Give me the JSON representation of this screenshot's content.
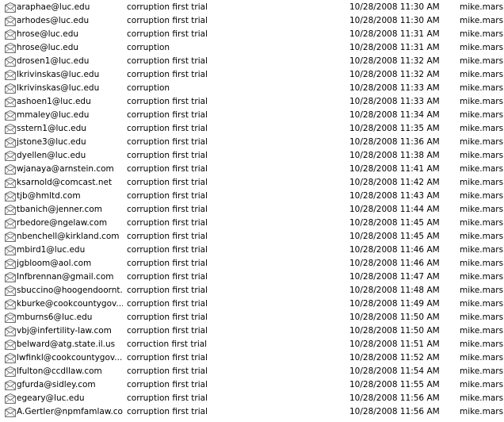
{
  "messages": [
    {
      "from": "araphae@luc.edu",
      "subject": "corruption first trial",
      "received": "10/28/2008 11:30 AM",
      "account": "mike.mars",
      "icon": "envelope-icon"
    },
    {
      "from": "arhodes@luc.edu",
      "subject": "corruption first trial",
      "received": "10/28/2008 11:30 AM",
      "account": "mike.mars",
      "icon": "envelope-icon"
    },
    {
      "from": "hrose@luc.edu",
      "subject": "corruption first trial",
      "received": "10/28/2008 11:31 AM",
      "account": "mike.mars",
      "icon": "envelope-icon"
    },
    {
      "from": "hrose@luc.edu",
      "subject": "corruption",
      "received": "10/28/2008 11:31 AM",
      "account": "mike.mars",
      "icon": "envelope-icon"
    },
    {
      "from": "drosen1@luc.edu",
      "subject": "corruption first trial",
      "received": "10/28/2008 11:32 AM",
      "account": "mike.mars",
      "icon": "envelope-icon"
    },
    {
      "from": "lkrivinskas@luc.edu",
      "subject": "corruption first trial",
      "received": "10/28/2008 11:32 AM",
      "account": "mike.mars",
      "icon": "envelope-icon"
    },
    {
      "from": "lkrivinskas@luc.edu",
      "subject": "corruption",
      "received": "10/28/2008 11:33 AM",
      "account": "mike.mars",
      "icon": "envelope-icon"
    },
    {
      "from": "ashoen1@luc.edu",
      "subject": "corruption first trial",
      "received": "10/28/2008 11:33 AM",
      "account": "mike.mars",
      "icon": "envelope-icon"
    },
    {
      "from": "mmaley@luc.edu",
      "subject": "corruption first trial",
      "received": "10/28/2008 11:34 AM",
      "account": "mike.mars",
      "icon": "envelope-icon"
    },
    {
      "from": "sstern1@luc.edu",
      "subject": "corruption first trial",
      "received": "10/28/2008 11:35 AM",
      "account": "mike.mars",
      "icon": "envelope-icon"
    },
    {
      "from": "jstone3@luc.edu",
      "subject": "corruption first trial",
      "received": "10/28/2008 11:36 AM",
      "account": "mike.mars",
      "icon": "envelope-icon"
    },
    {
      "from": "dyellen@luc.edu",
      "subject": "corruption first trial",
      "received": "10/28/2008 11:38 AM",
      "account": "mike.mars",
      "icon": "envelope-icon"
    },
    {
      "from": "wjanaya@arnstein.com",
      "subject": "corruption first trial",
      "received": "10/28/2008 11:41 AM",
      "account": "mike.mars",
      "icon": "envelope-icon"
    },
    {
      "from": "ksarnold@comcast.net",
      "subject": "corruption first trial",
      "received": "10/28/2008 11:42 AM",
      "account": "mike.mars",
      "icon": "envelope-icon"
    },
    {
      "from": "tjb@hmltd.com",
      "subject": "corruption first trial",
      "received": "10/28/2008 11:43 AM",
      "account": "mike.mars",
      "icon": "envelope-icon"
    },
    {
      "from": "tbanich@jenner.com",
      "subject": "corruption first trial",
      "received": "10/28/2008 11:44 AM",
      "account": "mike.mars",
      "icon": "envelope-icon"
    },
    {
      "from": "rbedore@ngelaw.com",
      "subject": "corruption first trial",
      "received": "10/28/2008 11:45 AM",
      "account": "mike.mars",
      "icon": "envelope-icon"
    },
    {
      "from": "nbenchell@kirkland.com",
      "subject": "corruption first trial",
      "received": "10/28/2008 11:45 AM",
      "account": "mike.mars",
      "icon": "envelope-icon"
    },
    {
      "from": "mbird1@luc.edu",
      "subject": "corruption first trial",
      "received": "10/28/2008 11:46 AM",
      "account": "mike.mars",
      "icon": "envelope-icon"
    },
    {
      "from": "jgbloom@aol.com",
      "subject": "corruption first trial",
      "received": "10/28/2008 11:46 AM",
      "account": "mike.mars",
      "icon": "envelope-icon"
    },
    {
      "from": "Infbrennan@gmail.com",
      "subject": "corruption first trial",
      "received": "10/28/2008 11:47 AM",
      "account": "mike.mars",
      "icon": "envelope-icon"
    },
    {
      "from": "sbuccino@hoogendoornt....",
      "subject": "corruption first trial",
      "received": "10/28/2008 11:48 AM",
      "account": "mike.mars",
      "icon": "envelope-icon"
    },
    {
      "from": "kburke@cookcountygov....",
      "subject": "corruption first trial",
      "received": "10/28/2008 11:49 AM",
      "account": "mike.mars",
      "icon": "envelope-icon"
    },
    {
      "from": "mburns6@luc.edu",
      "subject": "corruption first trial",
      "received": "10/28/2008 11:50 AM",
      "account": "mike.mars",
      "icon": "envelope-icon"
    },
    {
      "from": "vbj@infertility-law.com",
      "subject": "corruption first trial",
      "received": "10/28/2008 11:50 AM",
      "account": "mike.mars",
      "icon": "envelope-icon"
    },
    {
      "from": "belward@atg.state.il.us",
      "subject": "corruction first trial",
      "received": "10/28/2008 11:51 AM",
      "account": "mike.mars",
      "icon": "envelope-icon"
    },
    {
      "from": "lwfinkl@cookcountygov....",
      "subject": "corruption first trial",
      "received": "10/28/2008 11:52 AM",
      "account": "mike.mars",
      "icon": "envelope-icon"
    },
    {
      "from": "lfulton@ccdllaw.com",
      "subject": "corruption first trial",
      "received": "10/28/2008 11:54 AM",
      "account": "mike.mars",
      "icon": "envelope-icon"
    },
    {
      "from": "gfurda@sidley.com",
      "subject": "corruption first trial",
      "received": "10/28/2008 11:55 AM",
      "account": "mike.mars",
      "icon": "envelope-icon"
    },
    {
      "from": "egeary@luc.edu",
      "subject": "corruption first trial",
      "received": "10/28/2008 11:56 AM",
      "account": "mike.mars",
      "icon": "envelope-icon"
    },
    {
      "from": "A.Gertler@npmfamlaw.com",
      "subject": "corruption first trial",
      "received": "10/28/2008 11:56 AM",
      "account": "mike.mars",
      "icon": "envelope-icon"
    }
  ]
}
